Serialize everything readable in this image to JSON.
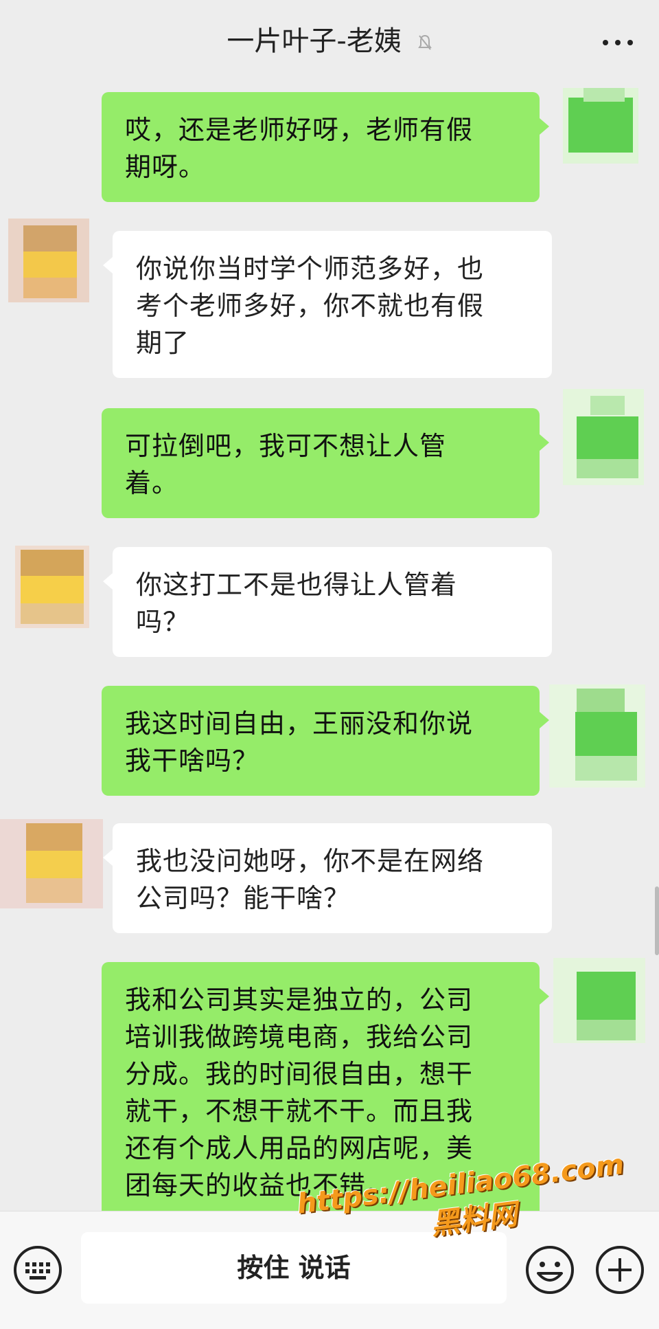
{
  "header": {
    "title": "一片叶子-老姨",
    "mute_icon": "mute-bell-icon",
    "more_icon": "more-dots-icon"
  },
  "messages": [
    {
      "from": "me",
      "lines": [
        "哎，还是老师好呀，老师有假",
        "期呀。"
      ]
    },
    {
      "from": "them",
      "lines": [
        "你说你当时学个师范多好，也",
        "考个老师多好，你不就也有假",
        "期了"
      ]
    },
    {
      "from": "me",
      "lines": [
        "可拉倒吧，我可不想让人管",
        "着。"
      ]
    },
    {
      "from": "them",
      "lines": [
        "你这打工不是也得让人管着",
        "吗？"
      ]
    },
    {
      "from": "me",
      "lines": [
        "我这时间自由，王丽没和你说",
        "我干啥吗？"
      ]
    },
    {
      "from": "them",
      "lines": [
        "我也没问她呀，你不是在网络",
        "公司吗？能干啥？"
      ]
    },
    {
      "from": "me",
      "lines": [
        "我和公司其实是独立的，公司",
        "培训我做跨境电商，我给公司",
        "分成。我的时间很自由，想干",
        "就干，不想干就不干。而且我",
        "还有个成人用品的网店呢，美",
        "团每天的收益也不错。"
      ]
    }
  ],
  "input_bar": {
    "keyboard_icon": "keyboard-icon",
    "voice_label": "按住 说话",
    "emoji_icon": "emoji-icon",
    "plus_icon": "plus-icon"
  },
  "watermark": {
    "url": "https://heiliao68.com",
    "name": "黑料网"
  },
  "colors": {
    "background": "#ededed",
    "my_bubble": "#95ec69",
    "their_bubble": "#ffffff",
    "watermark": "#f59a1c"
  }
}
